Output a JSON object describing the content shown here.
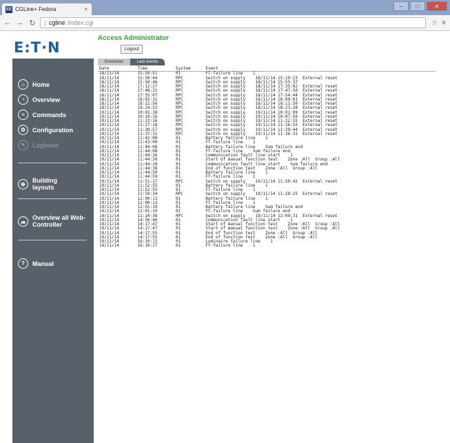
{
  "browser": {
    "tab_title": "CGLine+ Fedora",
    "tab_favicon": "EE",
    "tab_close": "×",
    "window_controls": [
      "–",
      "□",
      "✕"
    ],
    "url_host": "cgline",
    "url_path": "/index.cgi"
  },
  "header": {
    "logo_text": "E:T·N",
    "access_title": "Access Administrator",
    "logout_label": "Logout"
  },
  "sidebar": {
    "items": [
      {
        "label": "Home",
        "icon": "home-icon",
        "glyph": "⌂"
      },
      {
        "label": "Overview",
        "icon": "overview-icon",
        "glyph": "◔"
      },
      {
        "label": "Commands",
        "icon": "commands-icon",
        "glyph": "≡"
      },
      {
        "label": "Configuration",
        "icon": "configuration-icon",
        "glyph": "⚙"
      },
      {
        "label": "Logbook",
        "icon": "logbook-icon",
        "glyph": "✎"
      },
      {
        "label": "Building layouts",
        "icon": "building-icon",
        "glyph": "⊕"
      },
      {
        "label": "Overview all Web-Controller",
        "icon": "web-controller-icon",
        "glyph": "☁"
      },
      {
        "label": "Manual",
        "icon": "manual-icon",
        "glyph": "?"
      }
    ]
  },
  "content": {
    "tabs": [
      "Download",
      "Last events"
    ],
    "columns": [
      "Date",
      "Time",
      "System",
      "Event"
    ],
    "rows": [
      [
        "18/11/14",
        "15:50:51",
        "01",
        "FT-failure line    1"
      ],
      [
        "18/11/14",
        "15:50:44",
        "RPC",
        "Switch on supply    18/11/14 15:19:23  External reset"
      ],
      [
        "18/11/14",
        "15:50:46",
        "RPC",
        "Switch on supply    18/11/14 15:55:37"
      ],
      [
        "18/11/14",
        "17:12:27",
        "RPC",
        "Switch on supply    18/11/14 17:35:02  External reset"
      ],
      [
        "18/11/14",
        "17:48:31",
        "RPC",
        "Switch on supply    18/11/14 17:47:50  External reset"
      ],
      [
        "18/11/14",
        "17:55:07",
        "RPC",
        "Switch on supply    18/11/14 17:54:44  External reset"
      ],
      [
        "18/11/14",
        "18:02:31",
        "RPC",
        "Switch on supply    18/11/14 18:00:01  External reset"
      ],
      [
        "18/11/14",
        "18:12:56",
        "RPC",
        "Switch on supply    18/11/14 18:11:50  External reset"
      ],
      [
        "18/11/14",
        "18:24:53",
        "RPC",
        "Switch on supply    18/11/14 18:23:28  External reset"
      ],
      [
        "19/11/14",
        "10:01:38",
        "RPC",
        "Switch on supply    19/11/14 10:01:09  External reset"
      ],
      [
        "19/11/14",
        "10:10:16",
        "RPC",
        "Switch on supply    19/11/14 10:07:50  External reset"
      ],
      [
        "19/11/14",
        "11:23:16",
        "RPC",
        "Switch on supply    19/11/14 11:22:55  External reset"
      ],
      [
        "19/11/14",
        "11:27:18",
        "RPC",
        "Switch on supply    19/11/14 11:26:55  External reset"
      ],
      [
        "19/11/14",
        "11:30:57",
        "RPC",
        "Switch on supply    19/11/14 11:29:44  External reset"
      ],
      [
        "19/11/14",
        "11:37:31",
        "RPC",
        "Switch on supply    19/11/14 11:36:31  External reset"
      ],
      [
        "19/11/14",
        "11:42:08",
        "01",
        "Battery failure line    1"
      ],
      [
        "19/11/14",
        "11:43:00",
        "01",
        "FT-failure line    1"
      ],
      [
        "19/11/14",
        "11:44:08",
        "01",
        "Battery failure line    Sum failure end"
      ],
      [
        "19/11/14",
        "11:44:08",
        "01",
        "FT-failure line    Sum failure end"
      ],
      [
        "19/11/14",
        "11:44:26",
        "01",
        "Communication fault line start    1"
      ],
      [
        "19/11/14",
        "11:44:28",
        "01",
        "Start of manual function test    Zone :All  Group :All"
      ],
      [
        "19/11/14",
        "11:44:28",
        "01",
        "Communication fault line start    Sum failure end"
      ],
      [
        "19/11/14",
        "11:44:38",
        "01",
        "End of function test    Zone :All  Group :All"
      ],
      [
        "19/11/14",
        "11:44:50",
        "01",
        "Battery failure line    1"
      ],
      [
        "19/11/14",
        "11:44:59",
        "01",
        "FT-failure line    1"
      ],
      [
        "19/11/14",
        "11:51:17",
        "RPC",
        "Switch on supply    19/11/14 11:50:42  External reset"
      ],
      [
        "19/11/14",
        "11:52:55",
        "01",
        "Battery failure line    1"
      ],
      [
        "19/11/14",
        "11:52:55",
        "01",
        "FT-failure line    1"
      ],
      [
        "19/11/14",
        "11:59:34",
        "RPC",
        "Switch on supply    19/11/14 11:58:25  External reset"
      ],
      [
        "19/11/14",
        "12:00:13",
        "01",
        "Battery failure line    1"
      ],
      [
        "19/11/14",
        "12:00:13",
        "01",
        "FT-failure line    1"
      ],
      [
        "19/11/14",
        "12:01:19",
        "01",
        "Battery failure line    Sum failure end"
      ],
      [
        "19/11/14",
        "12:01:19",
        "01",
        "FT-failure line    Sum failure end"
      ],
      [
        "19/11/14",
        "12:10:38",
        "RPC",
        "Switch on supply    19/11/14 12:09:31  External reset"
      ],
      [
        "19/11/14",
        "14:56:46",
        "01",
        "Communication fault line start    1"
      ],
      [
        "19/11/14",
        "14:17:47",
        "01",
        "Start of manual function test    Zone :All  Group :All"
      ],
      [
        "19/11/14",
        "14:17:47",
        "01",
        "Start of manual function test    Zone :All  Group :All"
      ],
      [
        "19/11/14",
        "14:17:55",
        "01",
        "End of function test    Zone :All  Group :All"
      ],
      [
        "19/11/14",
        "14:17:55",
        "01",
        "End of function test    Zone :All  Group :All"
      ],
      [
        "19/11/14",
        "16:10:13",
        "01",
        "Luminaire failure line    1"
      ],
      [
        "19/11/14",
        "16:10:17",
        "01",
        "FT-failure line    1"
      ]
    ]
  }
}
